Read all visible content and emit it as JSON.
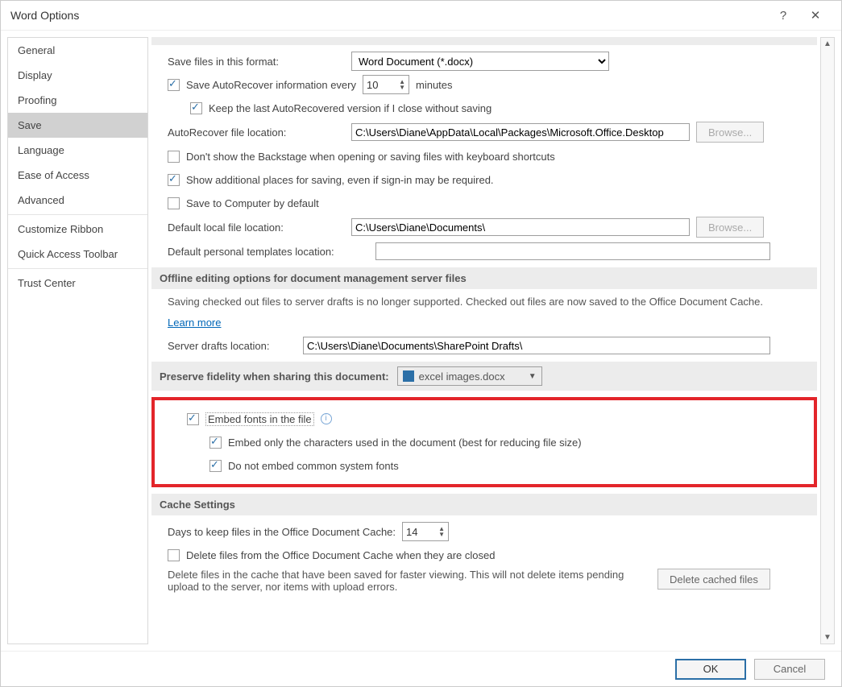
{
  "title": "Word Options",
  "sidebar": [
    "General",
    "Display",
    "Proofing",
    "Save",
    "Language",
    "Ease of Access",
    "Advanced",
    "Customize Ribbon",
    "Quick Access Toolbar",
    "Trust Center"
  ],
  "sidebar_selected": 3,
  "save": {
    "format_label": "Save files in this format:",
    "format_value": "Word Document (*.docx)",
    "autorecover_label": "Save AutoRecover information every",
    "autorecover_mins": "10",
    "minutes": "minutes",
    "keep_last": "Keep the last AutoRecovered version if I close without saving",
    "autorecover_loc_label": "AutoRecover file location:",
    "autorecover_loc": "C:\\Users\\Diane\\AppData\\Local\\Packages\\Microsoft.Office.Desktop",
    "browse": "Browse...",
    "dont_show_backstage": "Don't show the Backstage when opening or saving files with keyboard shortcuts",
    "show_additional": "Show additional places for saving, even if sign-in may be required.",
    "save_to_computer": "Save to Computer by default",
    "default_local_label": "Default local file location:",
    "default_local": "C:\\Users\\Diane\\Documents\\",
    "default_templates_label": "Default personal templates location:",
    "default_templates": ""
  },
  "offline": {
    "heading": "Offline editing options for document management server files",
    "desc": "Saving checked out files to server drafts is no longer supported. Checked out files are now saved to the Office Document Cache.",
    "learn_more": "Learn more",
    "server_drafts_label": "Server drafts location:",
    "server_drafts": "C:\\Users\\Diane\\Documents\\SharePoint Drafts\\"
  },
  "preserve": {
    "heading": "Preserve fidelity when sharing this document:",
    "doc": "excel images.docx",
    "embed": "Embed fonts in the file",
    "embed_only": "Embed only the characters used in the document (best for reducing file size)",
    "no_common": "Do not embed common system fonts"
  },
  "cache": {
    "heading": "Cache Settings",
    "days_label": "Days to keep files in the Office Document Cache:",
    "days": "14",
    "delete_closed": "Delete files from the Office Document Cache when they are closed",
    "desc": "Delete files in the cache that have been saved for faster viewing. This will not delete items pending upload to the server, nor items with upload errors.",
    "delete_btn": "Delete cached files"
  },
  "footer": {
    "ok": "OK",
    "cancel": "Cancel"
  }
}
